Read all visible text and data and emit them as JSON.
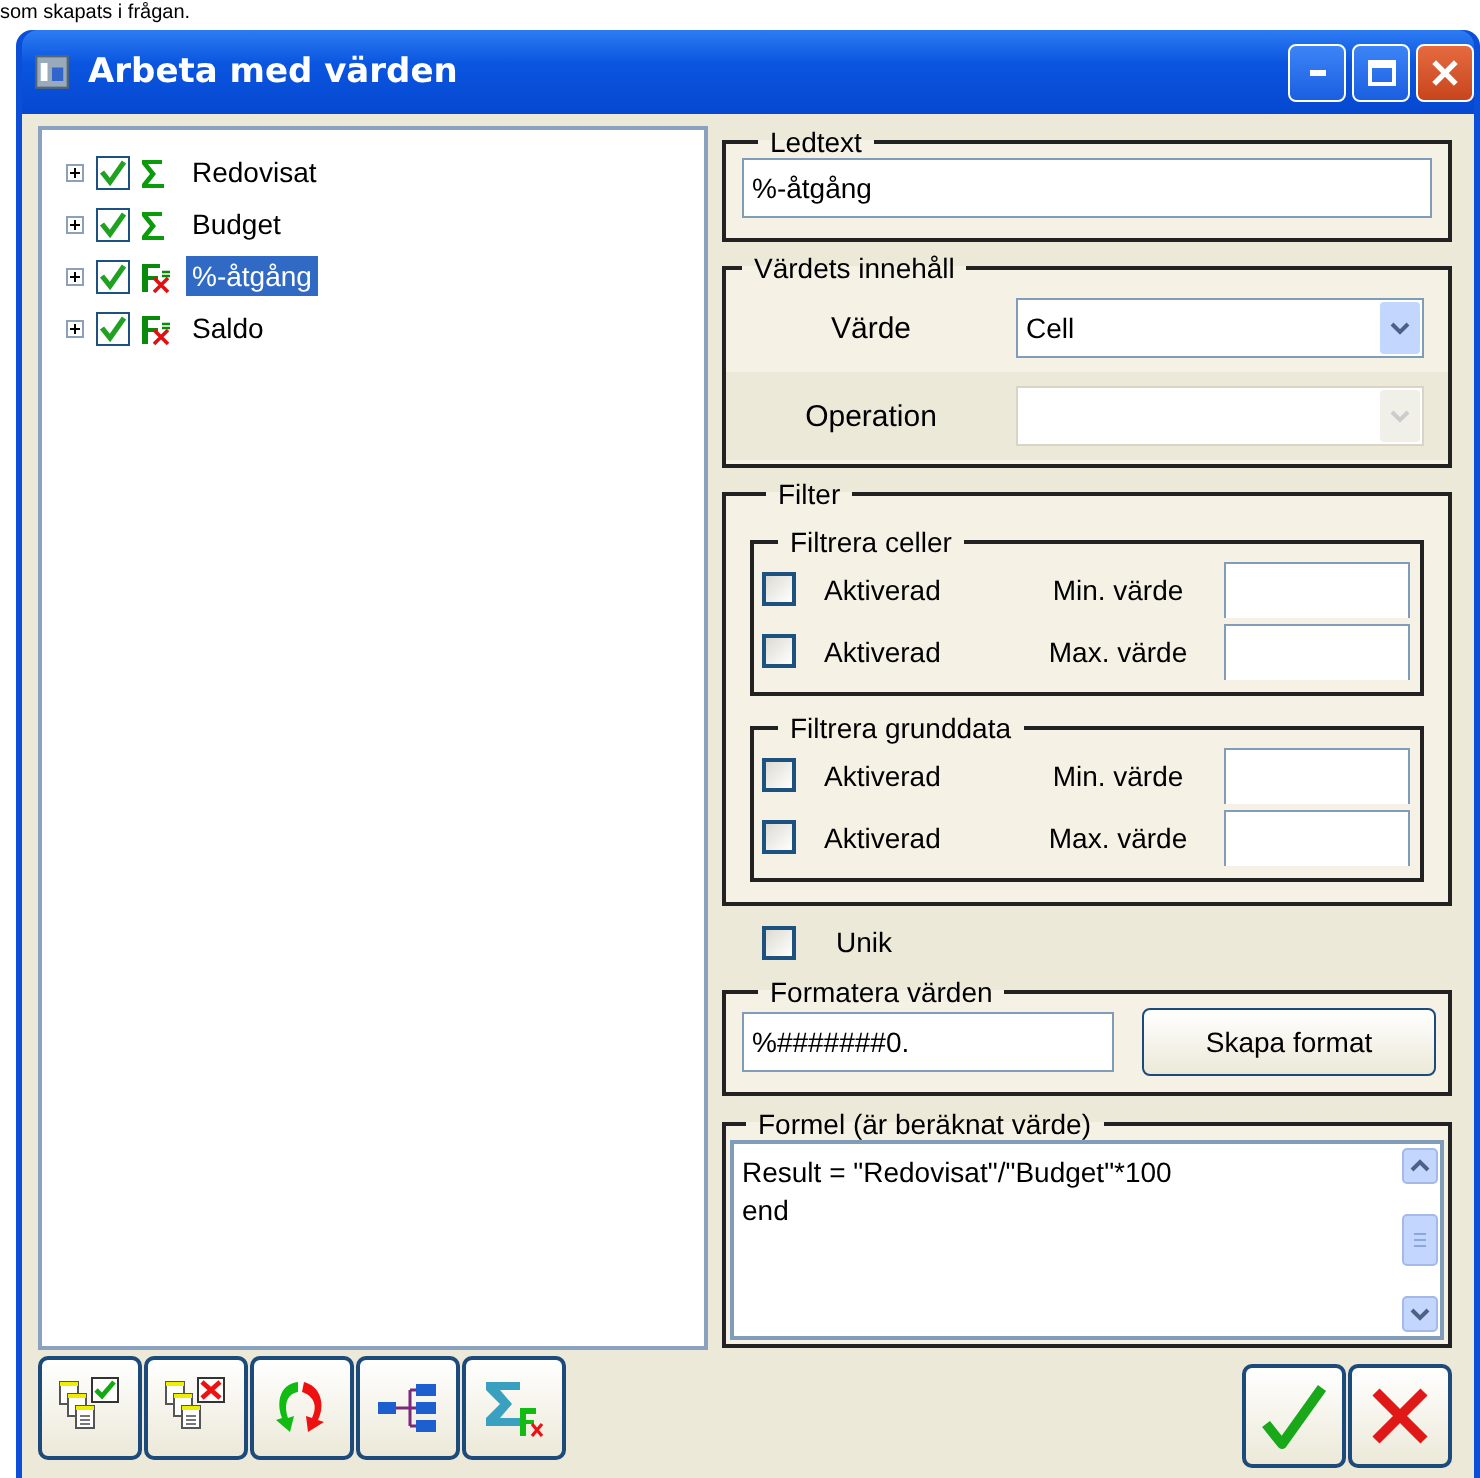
{
  "caption_fragment": "som skapats i frågan.",
  "window": {
    "title": "Arbeta med värden"
  },
  "tree": {
    "items": [
      {
        "label": "Redovisat",
        "kind": "sum",
        "checked": true,
        "expanded": false,
        "selected": false
      },
      {
        "label": "Budget",
        "kind": "sum",
        "checked": true,
        "expanded": false,
        "selected": false
      },
      {
        "label": "%-åtgång",
        "kind": "formula",
        "checked": true,
        "expanded": false,
        "selected": true
      },
      {
        "label": "Saldo",
        "kind": "formula",
        "checked": true,
        "expanded": false,
        "selected": false
      }
    ]
  },
  "ledtext": {
    "legend": "Ledtext",
    "value": "%-åtgång"
  },
  "content": {
    "legend": "Värdets innehåll",
    "fields": [
      {
        "label": "Värde",
        "value": "Cell",
        "disabled": false
      },
      {
        "label": "Operation",
        "disabled": true
      }
    ]
  },
  "filter": {
    "legend": "Filter",
    "groups": [
      {
        "legend": "Filtrera celler",
        "rows": [
          {
            "checked": false,
            "label": "Aktiverad",
            "bound": "Min. värde"
          },
          {
            "checked": false,
            "label": "Aktiverad",
            "bound": "Max. värde"
          }
        ]
      },
      {
        "legend": "Filtrera grunddata",
        "rows": [
          {
            "checked": false,
            "label": "Aktiverad",
            "bound": "Min. värde"
          },
          {
            "checked": false,
            "label": "Aktiverad",
            "bound": "Max. värde"
          }
        ]
      }
    ]
  },
  "unique": {
    "label": "Unik",
    "checked": false
  },
  "format": {
    "legend": "Formatera värden",
    "value": "%#######0.",
    "button": "Skapa format"
  },
  "formula": {
    "legend": "Formel (är beräknat värde)",
    "lines": [
      "Result = \"Redovisat\"/\"Budget\"*100",
      "end"
    ]
  },
  "toolbar": [
    {
      "kind": "check-all"
    },
    {
      "kind": "uncheck-all"
    },
    {
      "kind": "refresh"
    },
    {
      "kind": "hierarchy"
    },
    {
      "kind": "sum-fx"
    }
  ],
  "actions": [
    {
      "kind": "ok"
    },
    {
      "kind": "cancel"
    }
  ]
}
